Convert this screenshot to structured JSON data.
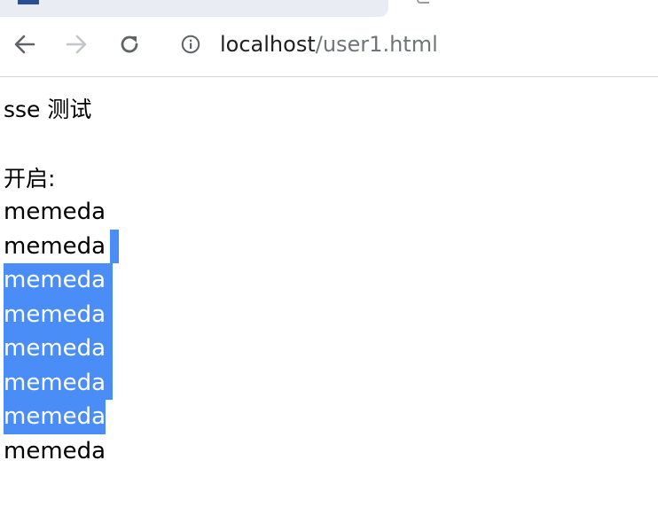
{
  "browser": {
    "url_host": "localhost",
    "url_path": "/user1.html",
    "colors": {
      "selection": "#4a8df6",
      "url_path": "#70757a"
    }
  },
  "page": {
    "heading": "sse 测试",
    "label": "开启:",
    "lines": [
      "memeda",
      "memeda",
      "memeda",
      "memeda",
      "memeda",
      "memeda",
      "memeda",
      "memeda"
    ]
  }
}
